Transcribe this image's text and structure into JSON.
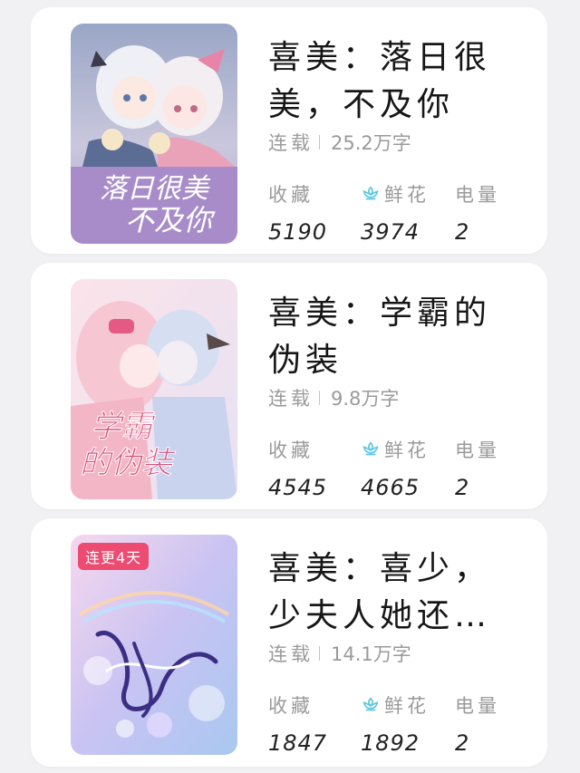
{
  "colors": {
    "background": "#f1f1f3",
    "card": "#ffffff",
    "title": "#161616",
    "muted": "#9a9a9a",
    "flower_icon": "#5ec7e2",
    "badge": "#ec4b72"
  },
  "books": [
    {
      "title": "喜美：落日很美，不及你",
      "status": "连载",
      "word_count": "25.2万字",
      "cover_text": "落日很美不及你",
      "stats": [
        {
          "label": "收藏",
          "value": "5190",
          "icon": null
        },
        {
          "label": "鲜花",
          "value": "3974",
          "icon": "flower-icon"
        },
        {
          "label": "电量",
          "value": "2",
          "icon": null
        }
      ]
    },
    {
      "title": "喜美：学霸的伪装",
      "status": "连载",
      "word_count": "9.8万字",
      "cover_text": "学霸的伪装",
      "stats": [
        {
          "label": "收藏",
          "value": "4545",
          "icon": null
        },
        {
          "label": "鲜花",
          "value": "4665",
          "icon": "flower-icon"
        },
        {
          "label": "电量",
          "value": "2",
          "icon": null
        }
      ]
    },
    {
      "title": "喜美：喜少，少夫人她还…",
      "status": "连载",
      "word_count": "14.1万字",
      "badge": "连更4天",
      "stats": [
        {
          "label": "收藏",
          "value": "1847",
          "icon": null
        },
        {
          "label": "鲜花",
          "value": "1892",
          "icon": "flower-icon"
        },
        {
          "label": "电量",
          "value": "2",
          "icon": null
        }
      ]
    }
  ]
}
